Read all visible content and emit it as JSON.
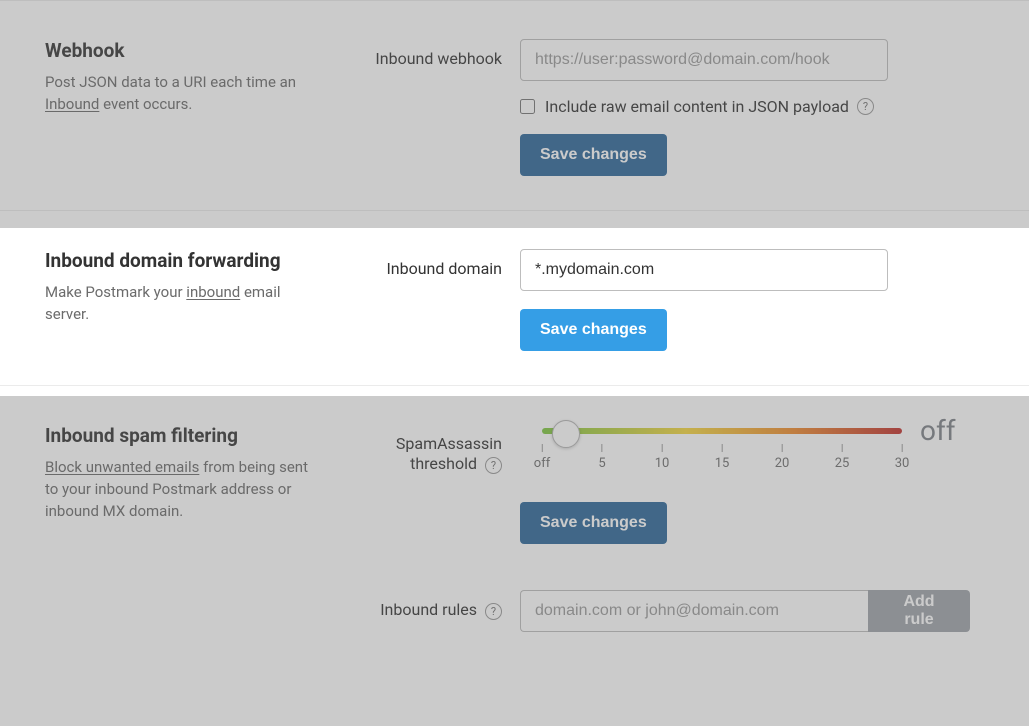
{
  "webhook": {
    "title": "Webhook",
    "desc_prefix": "Post JSON data to a URI each time an ",
    "desc_link": "Inbound",
    "desc_suffix": " event occurs.",
    "form_label": "Inbound webhook",
    "placeholder": "https://user:password@domain.com/hook",
    "value": "",
    "checkbox_label": "Include raw email content in JSON payload",
    "checkbox_checked": false,
    "save_label": "Save changes"
  },
  "domain_forwarding": {
    "title": "Inbound domain forwarding",
    "desc_prefix": "Make Postmark your ",
    "desc_link": "inbound",
    "desc_suffix": " email server.",
    "form_label": "Inbound domain",
    "value": "*.mydomain.com",
    "save_label": "Save changes"
  },
  "spam": {
    "title": "Inbound spam filtering",
    "desc_link": "Block unwanted emails",
    "desc_suffix": " from being sent to your inbound Postmark address or inbound MX domain.",
    "threshold_label": "SpamAssassin threshold",
    "slider_status": "off",
    "ticks": [
      "off",
      "5",
      "10",
      "15",
      "20",
      "25",
      "30"
    ],
    "save_label": "Save changes",
    "rules_label": "Inbound rules",
    "rules_placeholder": "domain.com or john@domain.com",
    "rules_value": "",
    "add_rule_label": "Add rule"
  },
  "help_glyph": "?"
}
